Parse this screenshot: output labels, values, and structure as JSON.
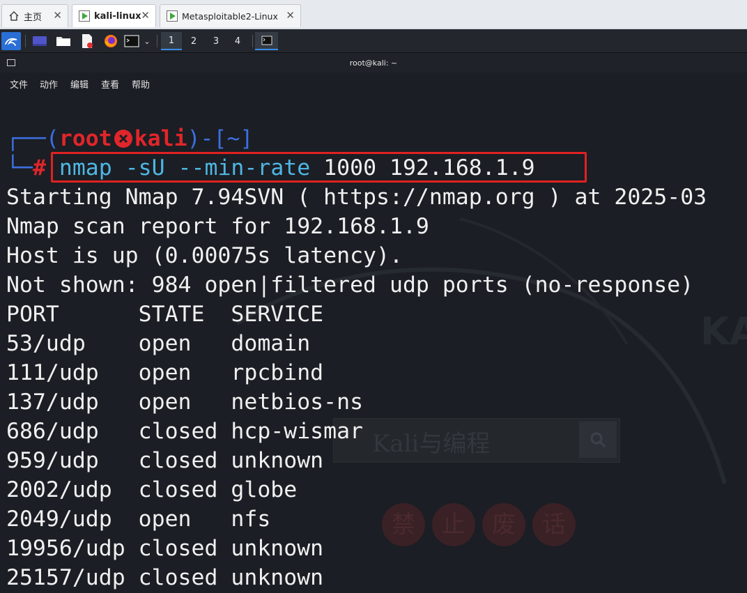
{
  "vmware_tabs": [
    {
      "label": "主页",
      "icon": "home-icon"
    },
    {
      "label": "kali-linux",
      "icon": "vm-icon"
    },
    {
      "label": "Metasploitable2-Linux",
      "icon": "vm-icon"
    }
  ],
  "panel": {
    "workspaces": [
      "1",
      "2",
      "3",
      "4"
    ],
    "active_workspace": "1"
  },
  "terminal": {
    "title": "root@kali: ~",
    "menu": [
      "文件",
      "动作",
      "编辑",
      "查看",
      "帮助"
    ],
    "prompt": {
      "open": "┌──(",
      "user": "root",
      "host": "kali",
      "path_part": ")-[~]",
      "hash_prefix": "└─",
      "hash": "#",
      "command_name": "nmap",
      "command_flags": "-sU --min-rate",
      "command_values": "1000 192.168.1.9"
    },
    "output": [
      "Starting Nmap 7.94SVN ( https://nmap.org ) at 2025-03",
      "Nmap scan report for 192.168.1.9",
      "Host is up (0.00075s latency).",
      "Not shown: 984 open|filtered udp ports (no-response)",
      "PORT      STATE  SERVICE",
      "53/udp    open   domain",
      "111/udp   open   rpcbind",
      "137/udp   open   netbios-ns",
      "686/udp   closed hcp-wismar",
      "959/udp   closed unknown",
      "2002/udp  closed globe",
      "2049/udp  open   nfs",
      "19956/udp closed unknown",
      "25157/udp closed unknown"
    ]
  },
  "watermark": {
    "search_text": "Kali与编程",
    "seal": [
      "禁",
      "止",
      "废",
      "话"
    ]
  },
  "colors": {
    "terminal_bg": "#1b1e24",
    "prompt_blue": "#3d6fe0",
    "prompt_red": "#e0262a",
    "command_cyan": "#4fb6e3",
    "highlight_box": "#e02222"
  }
}
